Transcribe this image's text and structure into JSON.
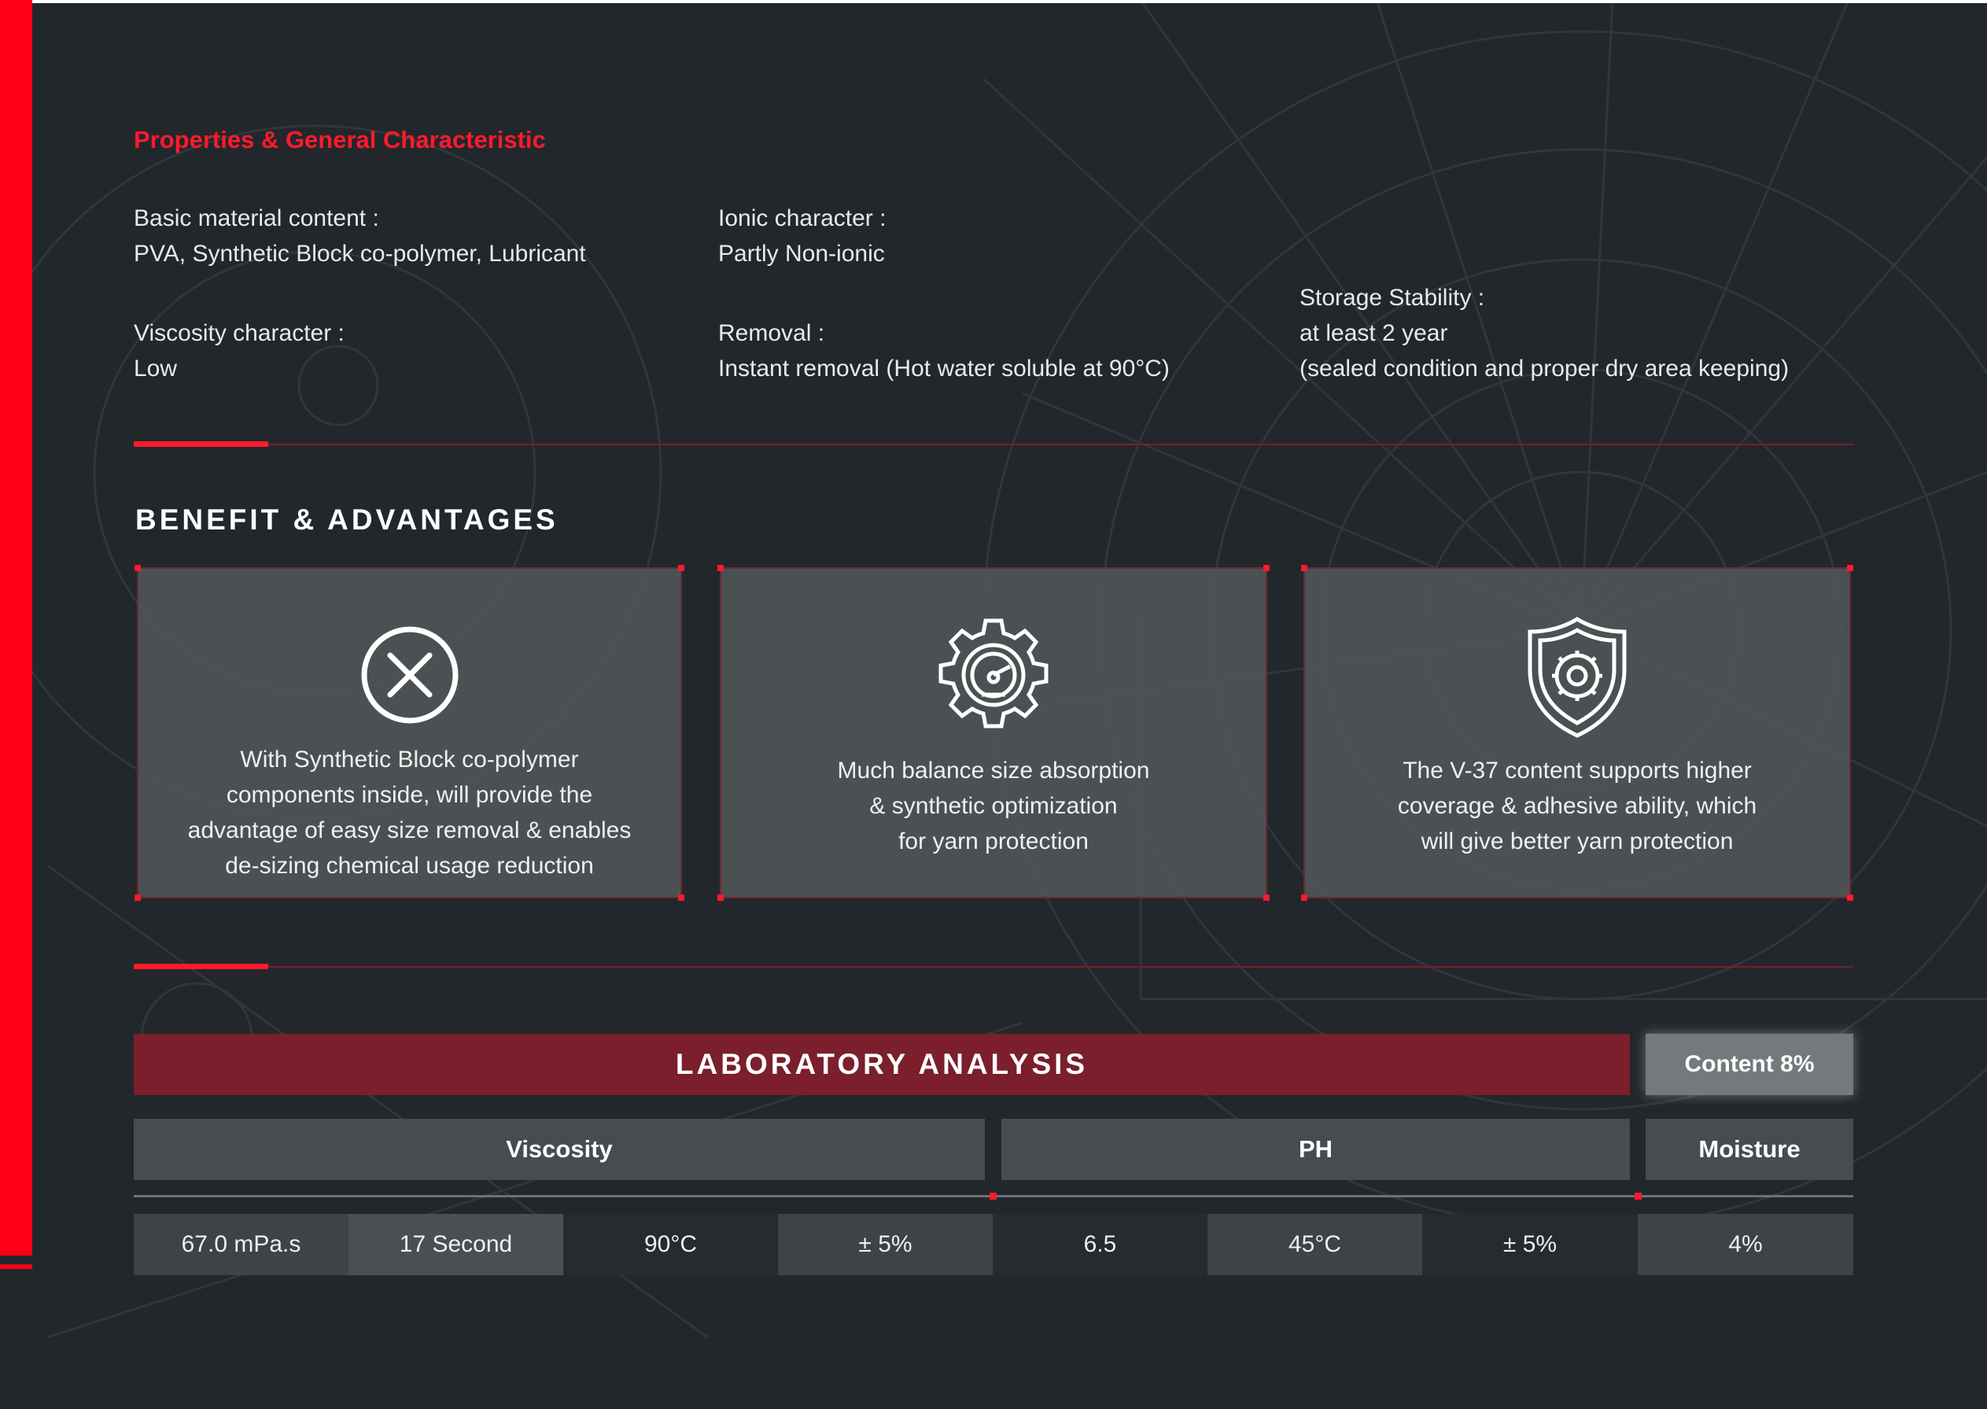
{
  "properties": {
    "title": "Properties & General Characteristic",
    "basic_material": {
      "label": "Basic material content :",
      "value": "PVA, Synthetic Block co-polymer, Lubricant"
    },
    "ionic": {
      "label": "Ionic character :",
      "value": "Partly Non-ionic"
    },
    "viscosity": {
      "label": "Viscosity character :",
      "value": "Low"
    },
    "removal": {
      "label": "Removal :",
      "value": "Instant removal (Hot water soluble at 90°C)"
    },
    "storage": {
      "label": "Storage Stability :",
      "value": "at least 2 year",
      "note": "(sealed condition and proper dry area keeping)"
    }
  },
  "benefits": {
    "title": "BENEFIT & ADVANTAGES",
    "cards": [
      {
        "icon": "x-circle-icon",
        "lines": [
          "With Synthetic Block co-polymer",
          "components inside, will provide the",
          "advantage of easy size removal & enables",
          "de-sizing chemical usage reduction"
        ]
      },
      {
        "icon": "gear-gauge-icon",
        "lines": [
          "Much balance size absorption",
          "& synthetic optimization",
          "for yarn protection"
        ]
      },
      {
        "icon": "shield-gear-icon",
        "lines": [
          "The V-37 content supports higher",
          "coverage & adhesive ability, which",
          "will give better yarn protection"
        ]
      }
    ]
  },
  "lab": {
    "title": "LABORATORY ANALYSIS",
    "content_badge": "Content 8%",
    "columns": [
      "Viscosity",
      "PH",
      "Moisture"
    ],
    "values": [
      "67.0 mPa.s",
      "17 Second",
      "90°C",
      "± 5%",
      "6.5",
      "45°C",
      "± 5%",
      "4%"
    ]
  },
  "colors": {
    "accent": "#ff1a2c",
    "background": "#22272b",
    "lab_header": "#7a1f2b",
    "card": "#54595d"
  }
}
